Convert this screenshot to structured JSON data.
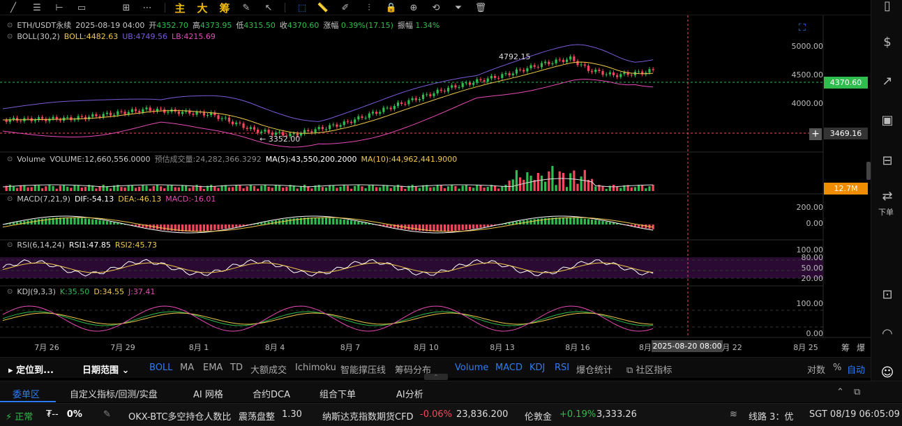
{
  "toolbar": {
    "main": "主",
    "big": "大",
    "chips": "筹"
  },
  "symbol": {
    "pair": "ETH/USDT永续",
    "time": "2025-08-19 04:00",
    "open_label": "开",
    "open": "4352.70",
    "high_label": "高",
    "high": "4373.95",
    "low_label": "低",
    "low": "4315.50",
    "close_label": "收",
    "close": "4370.60",
    "chg_label": "涨幅",
    "chg": "0.39%(17.15)",
    "amp_label": "振幅",
    "amp": "1.34%"
  },
  "boll": {
    "name": "BOLL(30,2)",
    "boll": "BOLL:4482.63",
    "ub": "UB:4749.56",
    "lb": "LB:4215.69"
  },
  "volume": {
    "name": "Volume",
    "vol": "VOLUME:12,660,556.0000",
    "est": "预估成交量:24,282,366.3292",
    "ma5": "MA(5):43,550,200.2000",
    "ma10": "MA(10):44,962,441.9000"
  },
  "macd": {
    "name": "MACD(7,21,9)",
    "dif": "DIF:-54.13",
    "dea": "DEA:-46.13",
    "macd": "MACD:-16.01"
  },
  "rsi": {
    "name": "RSI(6,14,24)",
    "rsi1": "RSI1:47.85",
    "rsi2": "RSI2:45.73"
  },
  "kdj": {
    "name": "KDJ(9,3,3)",
    "k": "K:35.50",
    "d": "D:34.55",
    "j": "J:37.41"
  },
  "price_axis": [
    "5000.00",
    "4500.00",
    "4000.00"
  ],
  "price_high_label": "4792.15",
  "price_low_label": "3352.00",
  "last_price": "4370.60",
  "crosshair_price": "3469.16",
  "vol_tag": "12.7M",
  "macd_axis": [
    "200.00",
    "0.00"
  ],
  "rsi_axis": [
    "100.00",
    "80.00",
    "50.00",
    "20.00"
  ],
  "kdj_axis": [
    "100.00",
    "0.00"
  ],
  "dates": [
    "7月 26",
    "7月 29",
    "8月 1",
    "8月 4",
    "8月 7",
    "8月 10",
    "8月 13",
    "8月 16",
    "8月",
    "8月 22",
    "8月 25"
  ],
  "crosshair_time": "2025-08-20 08:00",
  "corner": {
    "a": "筹",
    "b": "爆"
  },
  "indbar": {
    "locate": "定位到...",
    "range": "日期范围",
    "inds": [
      "BOLL",
      "MA",
      "EMA",
      "TD",
      "大额成交",
      "Ichimoku",
      "智能撑压线",
      "筹码分布"
    ],
    "subs": [
      "Volume",
      "MACD",
      "KDJ",
      "RSI",
      "爆仓统计"
    ],
    "community": "社区指标",
    "log": "对数",
    "pct": "%",
    "auto": "自动"
  },
  "tabs": [
    "委单区",
    "自定义指标/回测/实盘",
    "AI 网格",
    "合约DCA",
    "组合下单",
    "AI分析"
  ],
  "right_sell": "下单",
  "status": {
    "normal": "正常",
    "pct": "0%",
    "ticker1": "OKX-BTC多空持仓人数比",
    "t1a": "震荡盘整",
    "t1b": "1.30",
    "ticker2": "纳斯达克指数期货CFD",
    "t2chg": "-0.06%",
    "t2val": "23,836.200",
    "ticker3": "伦敦金",
    "t3chg": "+0.19%",
    "t3val": "3,333.26",
    "line": "线路 3：优",
    "time": "SGT  08/19 06:05:09"
  },
  "colors": {
    "up": "#2ebd4e",
    "down": "#f6465d",
    "boll_mid": "#f0c94a",
    "ub": "#7a5bd8",
    "lb": "#e64bb5",
    "accent": "#2d7cf6"
  }
}
